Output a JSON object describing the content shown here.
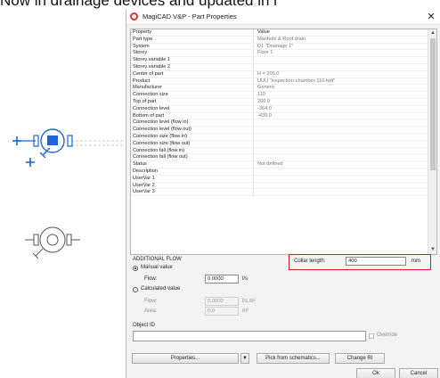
{
  "caption": "Now in drainage devices and updated in r",
  "dialog": {
    "title": "MagiCAD V&P - Part Properties",
    "close_glyph": "✕"
  },
  "properties": {
    "header": {
      "property": "Property",
      "value": "Value"
    },
    "rows": [
      {
        "property": "Part type",
        "value": "Manhole & Roof drain"
      },
      {
        "property": "System",
        "value": "D1 \"Drainage 1\""
      },
      {
        "property": "Storey",
        "value": "Floor 1"
      },
      {
        "property": "Storey variable 1",
        "value": ""
      },
      {
        "property": "Storey variable 2",
        "value": ""
      },
      {
        "property": "Center of part",
        "value": "H = 200.0"
      },
      {
        "property": "Product",
        "value": "UUU \"inspection-chamber-110-lwlt\""
      },
      {
        "property": "Manufacturer",
        "value": "Generic"
      },
      {
        "property": "Connection size",
        "value": "110"
      },
      {
        "property": "Top of part",
        "value": "200.0"
      },
      {
        "property": "Connection level",
        "value": "-364.0"
      },
      {
        "property": "Bottom of part",
        "value": "-439.0"
      },
      {
        "property": "Connection level (flow in)",
        "value": ""
      },
      {
        "property": "Connection level (flow out)",
        "value": ""
      },
      {
        "property": "Connection size (flow in)",
        "value": ""
      },
      {
        "property": "Connection size (flow out)",
        "value": ""
      },
      {
        "property": "Connection fall (flow in)",
        "value": ""
      },
      {
        "property": "Connection fall (flow out)",
        "value": ""
      },
      {
        "property": "Status",
        "value": "Not defined"
      },
      {
        "property": "Description",
        "value": ""
      },
      {
        "property": "UserVar 1",
        "value": ""
      },
      {
        "property": "UserVar 2",
        "value": ""
      },
      {
        "property": "UserVar 3",
        "value": ""
      }
    ]
  },
  "additional_flow": {
    "title": "ADDITIONAL FLOW",
    "manual_label": "Manual value",
    "manual_flow_label": "Flow:",
    "manual_flow_value": "0.0000",
    "manual_flow_unit": "l/s",
    "calculated_label": "Calculated value",
    "calc_flow_label": "Flow:",
    "calc_flow_value": "0.0000",
    "calc_flow_unit": "l/s,m²",
    "area_label": "Area:",
    "area_value": "0.0",
    "area_unit": "m²"
  },
  "collar": {
    "label": "Collar length:",
    "value": "400",
    "unit": "mm",
    "highlight_color": "#d21f1f"
  },
  "object_id": {
    "label": "Object ID",
    "value": "",
    "override_label": "Override"
  },
  "buttons": {
    "properties": "Properties...",
    "dropdown_glyph": "▼",
    "pick": "Pick from schematics...",
    "change": "Change RI",
    "ok": "Ok",
    "cancel": "Cancel"
  },
  "colors": {
    "selection_blue": "#1e66d6",
    "symbol_grey": "#555555"
  }
}
